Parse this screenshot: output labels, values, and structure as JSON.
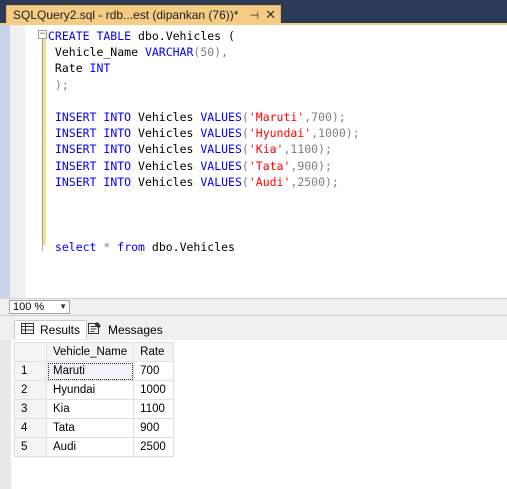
{
  "tab": {
    "title": "SQLQuery2.sql - rdb...est (dipankan (76))*",
    "pin_glyph": "⊣",
    "close_glyph": "✕"
  },
  "editor": {
    "collapse_glyph": "−",
    "create_line1": {
      "kw1": "CREATE TABLE",
      "text": " dbo.Vehicles ("
    },
    "create_line2": {
      "text1": " Vehicle_Name ",
      "kw": "VARCHAR",
      "text2": "(50),"
    },
    "create_line3": {
      "text1": " Rate ",
      "kw": "INT"
    },
    "create_line4": {
      "text": " );"
    },
    "inserts": [
      {
        "kw1": "INSERT INTO",
        "table": " Vehicles ",
        "kw2": "VALUES",
        "open": "(",
        "str": "'Maruti'",
        "rest": ",700);"
      },
      {
        "kw1": "INSERT INTO",
        "table": " Vehicles ",
        "kw2": "VALUES",
        "open": "(",
        "str": "'Hyundai'",
        "rest": ",1000);"
      },
      {
        "kw1": "INSERT INTO",
        "table": " Vehicles ",
        "kw2": "VALUES",
        "open": "(",
        "str": "'Kia'",
        "rest": ",1100);"
      },
      {
        "kw1": "INSERT INTO",
        "table": " Vehicles ",
        "kw2": "VALUES",
        "open": "(",
        "str": "'Tata'",
        "rest": ",900);"
      },
      {
        "kw1": "INSERT INTO",
        "table": " Vehicles ",
        "kw2": "VALUES",
        "open": "(",
        "str": "'Audi'",
        "rest": ",2500);"
      }
    ],
    "select_line": {
      "kw1": "select",
      "star": " * ",
      "kw2": "from",
      "text": " dbo.Vehicles"
    }
  },
  "zoom": {
    "value": "100 %",
    "arrow": "▼"
  },
  "results_tabs": [
    {
      "label": "Results",
      "icon": "grid-icon"
    },
    {
      "label": "Messages",
      "icon": "messages-icon"
    }
  ],
  "grid": {
    "columns": [
      "Vehicle_Name",
      "Rate"
    ],
    "rows": [
      {
        "num": "1",
        "name": "Maruti",
        "rate": "700"
      },
      {
        "num": "2",
        "name": "Hyundai",
        "rate": "1000"
      },
      {
        "num": "3",
        "name": "Kia",
        "rate": "1100"
      },
      {
        "num": "4",
        "name": "Tata",
        "rate": "900"
      },
      {
        "num": "5",
        "name": "Audi",
        "rate": "2500"
      }
    ]
  },
  "colors": {
    "tab_active": "#f5cc84",
    "titlebar": "#2b3a55",
    "keyword": "#0000ff",
    "string": "#ff0000"
  }
}
